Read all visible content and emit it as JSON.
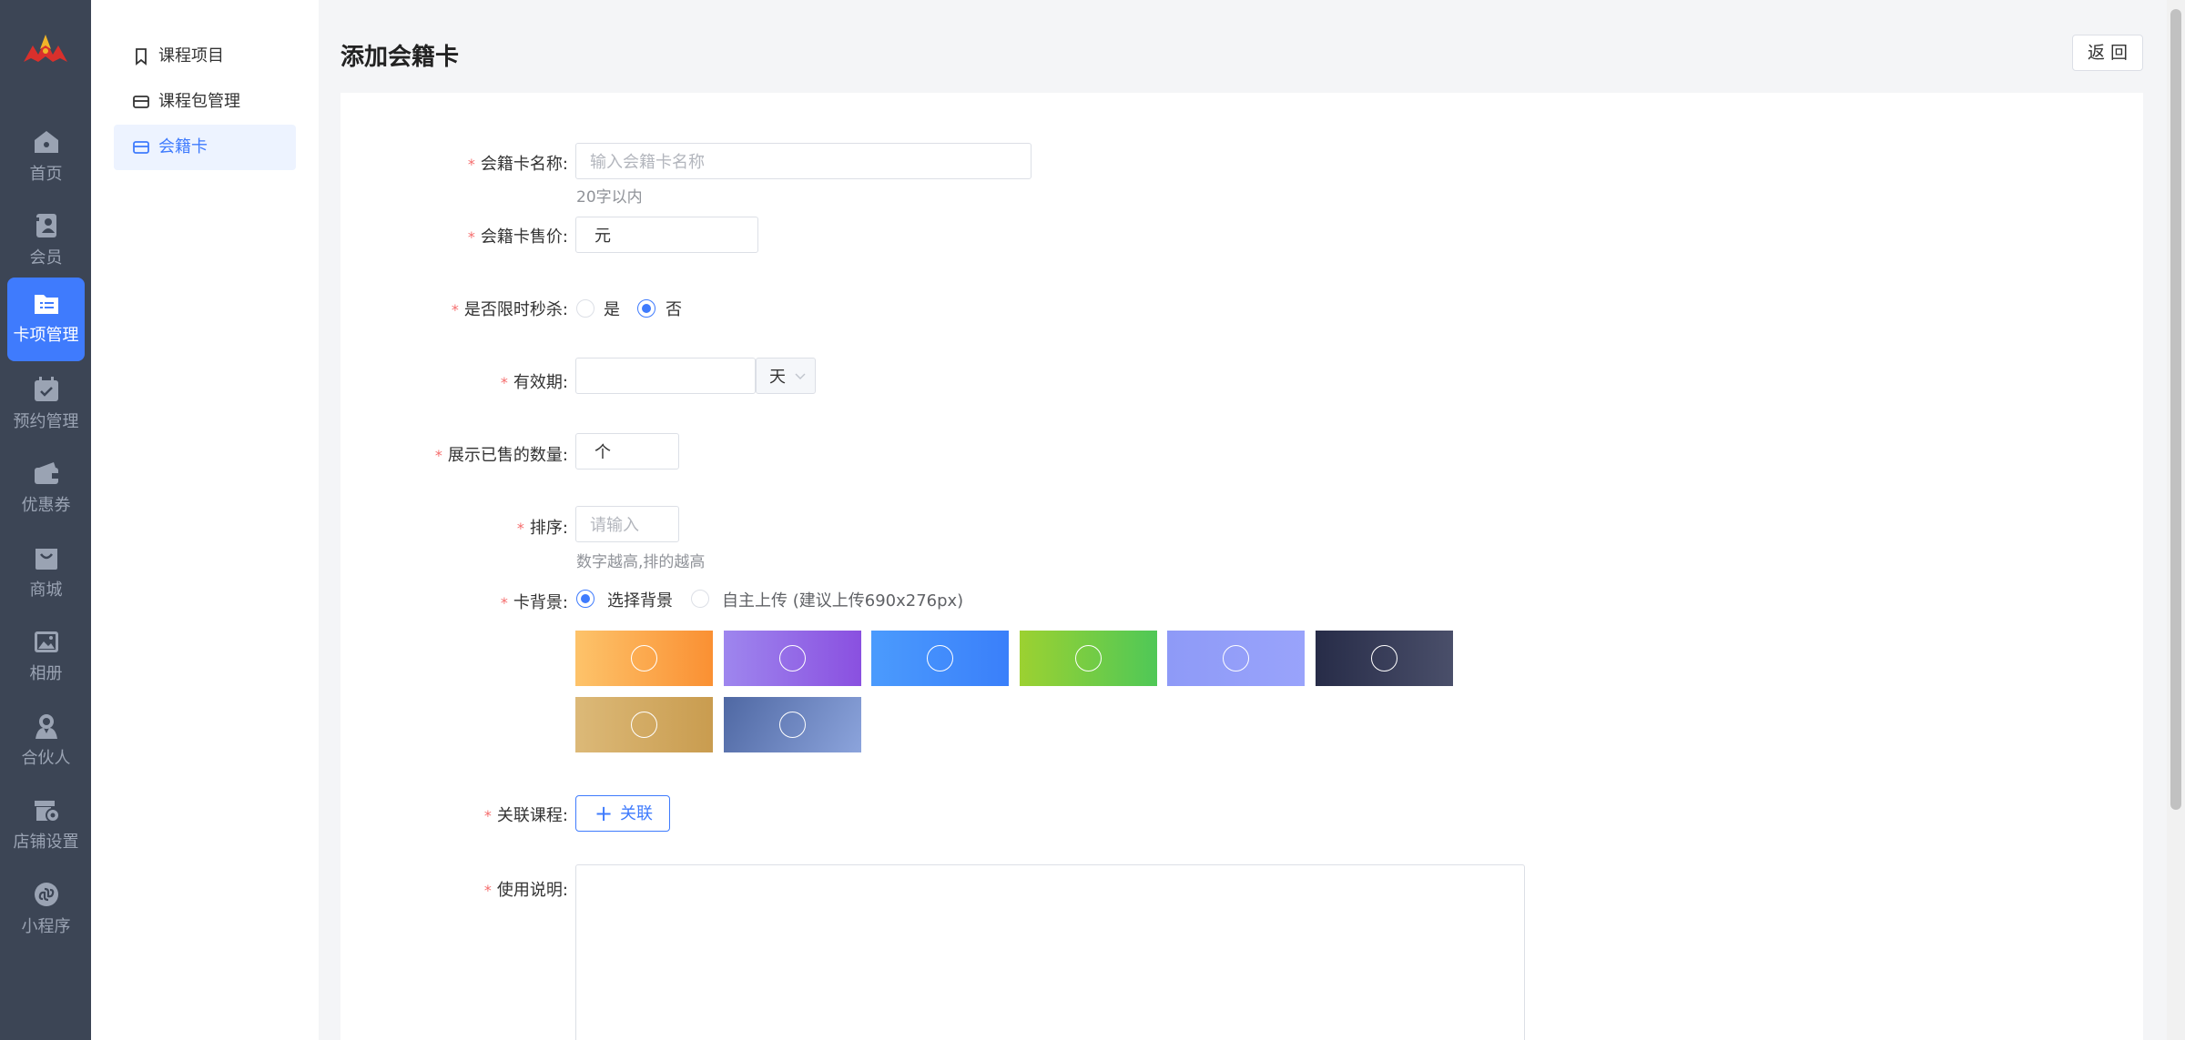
{
  "nav": {
    "items": [
      {
        "label": "首页",
        "icon": "home-icon"
      },
      {
        "label": "会员",
        "icon": "member-icon"
      },
      {
        "label": "卡项管理",
        "icon": "card-folder-icon",
        "active": true
      },
      {
        "label": "预约管理",
        "icon": "calendar-check-icon"
      },
      {
        "label": "优惠券",
        "icon": "coupon-icon"
      },
      {
        "label": "商城",
        "icon": "shop-bag-icon"
      },
      {
        "label": "相册",
        "icon": "album-icon"
      },
      {
        "label": "合伙人",
        "icon": "partner-icon"
      },
      {
        "label": "店铺设置",
        "icon": "store-settings-icon"
      },
      {
        "label": "小程序",
        "icon": "mini-program-icon"
      }
    ],
    "active_color": "#3f7bfd",
    "bg_color": "#3c4555"
  },
  "submenu": {
    "items": [
      {
        "label": "课程项目",
        "icon": "bookmark-icon"
      },
      {
        "label": "课程包管理",
        "icon": "card-icon"
      },
      {
        "label": "会籍卡",
        "icon": "card-icon",
        "active": true
      }
    ]
  },
  "header": {
    "title": "添加会籍卡",
    "back_label": "返 回"
  },
  "form": {
    "name": {
      "label": "会籍卡名称:",
      "placeholder": "输入会籍卡名称",
      "hint": "20字以内"
    },
    "price": {
      "label": "会籍卡售价:",
      "suffix": "元"
    },
    "flash_sale": {
      "label": "是否限时秒杀:",
      "options": [
        "是",
        "否"
      ],
      "selected": "否"
    },
    "validity": {
      "label": "有效期:",
      "unit": "天"
    },
    "sold_count": {
      "label": "展示已售的数量:",
      "suffix": "个"
    },
    "sort": {
      "label": "排序:",
      "placeholder": "请输入",
      "hint": "数字越高,排的越高"
    },
    "background": {
      "label": "卡背景:",
      "options": [
        "选择背景",
        "自主上传 (建议上传690x276px)"
      ],
      "selected": "选择背景",
      "swatches": [
        {
          "name": "orange",
          "from": "#fdc36a",
          "to": "#fa9033"
        },
        {
          "name": "purple",
          "from": "#9e86ee",
          "to": "#8a50e0"
        },
        {
          "name": "blue",
          "from": "#4b9bfd",
          "to": "#3a7ffa"
        },
        {
          "name": "green",
          "from": "#9cd131",
          "to": "#4fc857"
        },
        {
          "name": "periwinkle",
          "from": "#8e9af7",
          "to": "#99a3fb"
        },
        {
          "name": "dark-navy",
          "from": "#272c48",
          "to": "#4a4f6a"
        },
        {
          "name": "gold",
          "from": "#dcb978",
          "to": "#c99c4f"
        },
        {
          "name": "steel-blue",
          "from": "#4f68a3",
          "to": "#8ca4dc"
        }
      ]
    },
    "courses": {
      "label": "关联课程:",
      "button": "关联"
    },
    "description": {
      "label": "使用说明:"
    }
  }
}
